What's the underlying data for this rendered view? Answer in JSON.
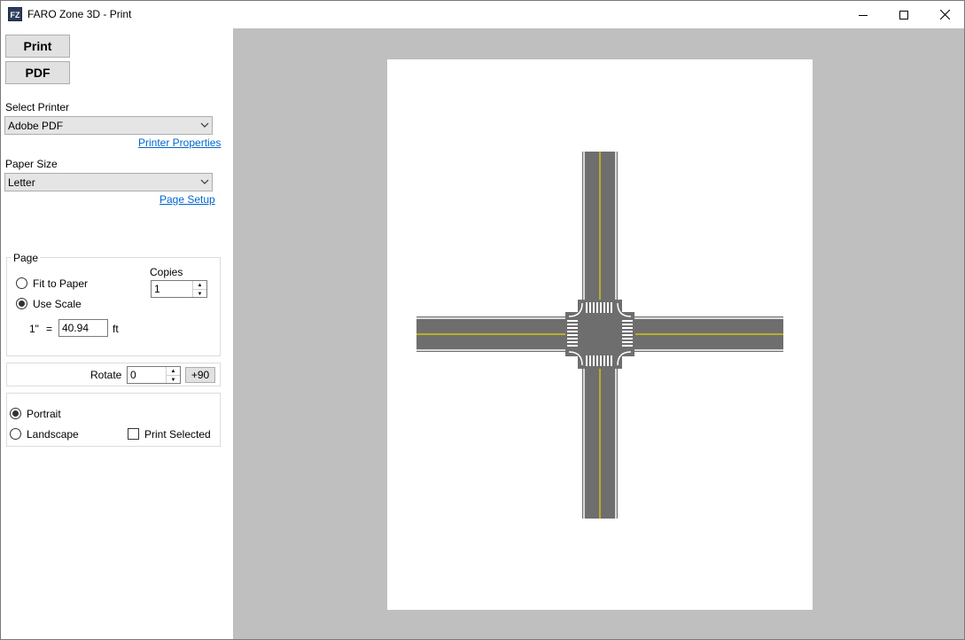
{
  "window": {
    "icon_text": "FZ",
    "title": "FARO Zone 3D - Print"
  },
  "toolbar": {
    "print_label": "Print",
    "pdf_label": "PDF"
  },
  "printer": {
    "label": "Select Printer",
    "selected": "Adobe PDF",
    "properties_link": "Printer Properties"
  },
  "paper": {
    "label": "Paper Size",
    "selected": "Letter",
    "setup_link": "Page Setup"
  },
  "page": {
    "group_label": "Page",
    "fit_label": "Fit to Paper",
    "scale_label": "Use Scale",
    "scale_prefix": "1\"",
    "scale_eq": "=",
    "scale_value": "40.94",
    "scale_unit": "ft",
    "copies_label": "Copies",
    "copies_value": "1",
    "mode": "use-scale"
  },
  "rotate": {
    "label": "Rotate",
    "value": "0",
    "plus90_label": "+90"
  },
  "orientation": {
    "portrait_label": "Portrait",
    "landscape_label": "Landscape",
    "print_selected_label": "Print Selected",
    "selected": "portrait",
    "print_selected_checked": false
  },
  "colors": {
    "road": "#6e6e6e",
    "center_line": "#e8d500",
    "edge_line": "#ffffff",
    "preview_bg": "#bfbfbf",
    "link": "#0066cc"
  },
  "icons": {
    "minimize": "minimize-icon",
    "maximize": "maximize-icon",
    "close": "close-icon",
    "dropdown": "chevron-down-icon"
  }
}
